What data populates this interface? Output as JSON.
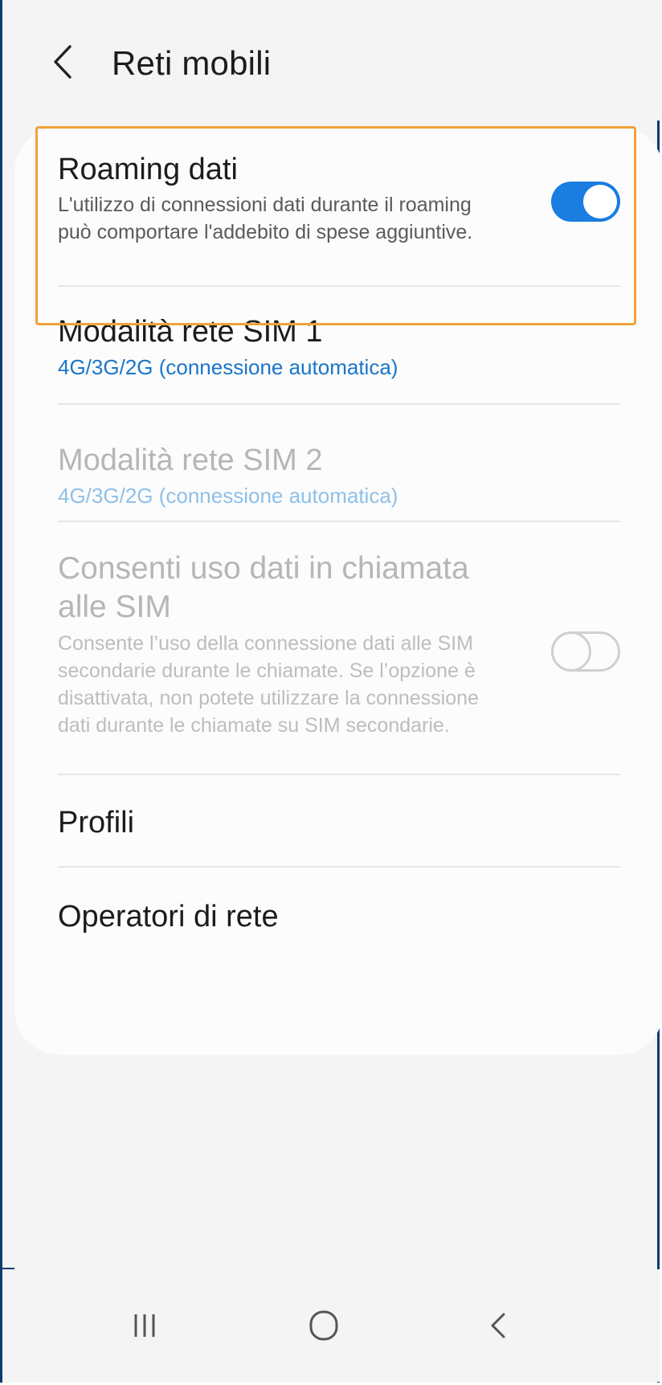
{
  "header": {
    "title": "Reti mobili",
    "back_icon": "chevron-left-icon"
  },
  "settings": {
    "roaming": {
      "title": "Roaming dati",
      "description": "L'utilizzo di connessioni dati durante il roaming può comportare l'addebito di spese aggiuntive.",
      "enabled": true
    },
    "sim1": {
      "title": "Modalità rete SIM 1",
      "value": "4G/3G/2G (connessione automatica)"
    },
    "sim2": {
      "title": "Modalità rete SIM 2",
      "value": "4G/3G/2G (connessione automatica)",
      "disabled": true
    },
    "data_during_calls": {
      "title": "Consenti uso dati in chiamata alle SIM",
      "description": "Consente l’uso della connessione dati alle SIM secondarie durante le chiamate. Se l’opzione è disattivata, non potete utilizzare la connessione dati durante le chiamate su SIM secondarie.",
      "enabled": false,
      "disabled": true
    },
    "profiles": {
      "title": "Profili"
    },
    "operators": {
      "title": "Operatori di rete"
    }
  },
  "navbar": {
    "recents_icon": "recent-apps-icon",
    "home_icon": "home-icon",
    "back_icon": "back-icon"
  },
  "colors": {
    "accent": "#1a7de0",
    "highlight": "#f0a23a",
    "frame": "#0e3a6e",
    "link_blue": "#1a75c9"
  }
}
